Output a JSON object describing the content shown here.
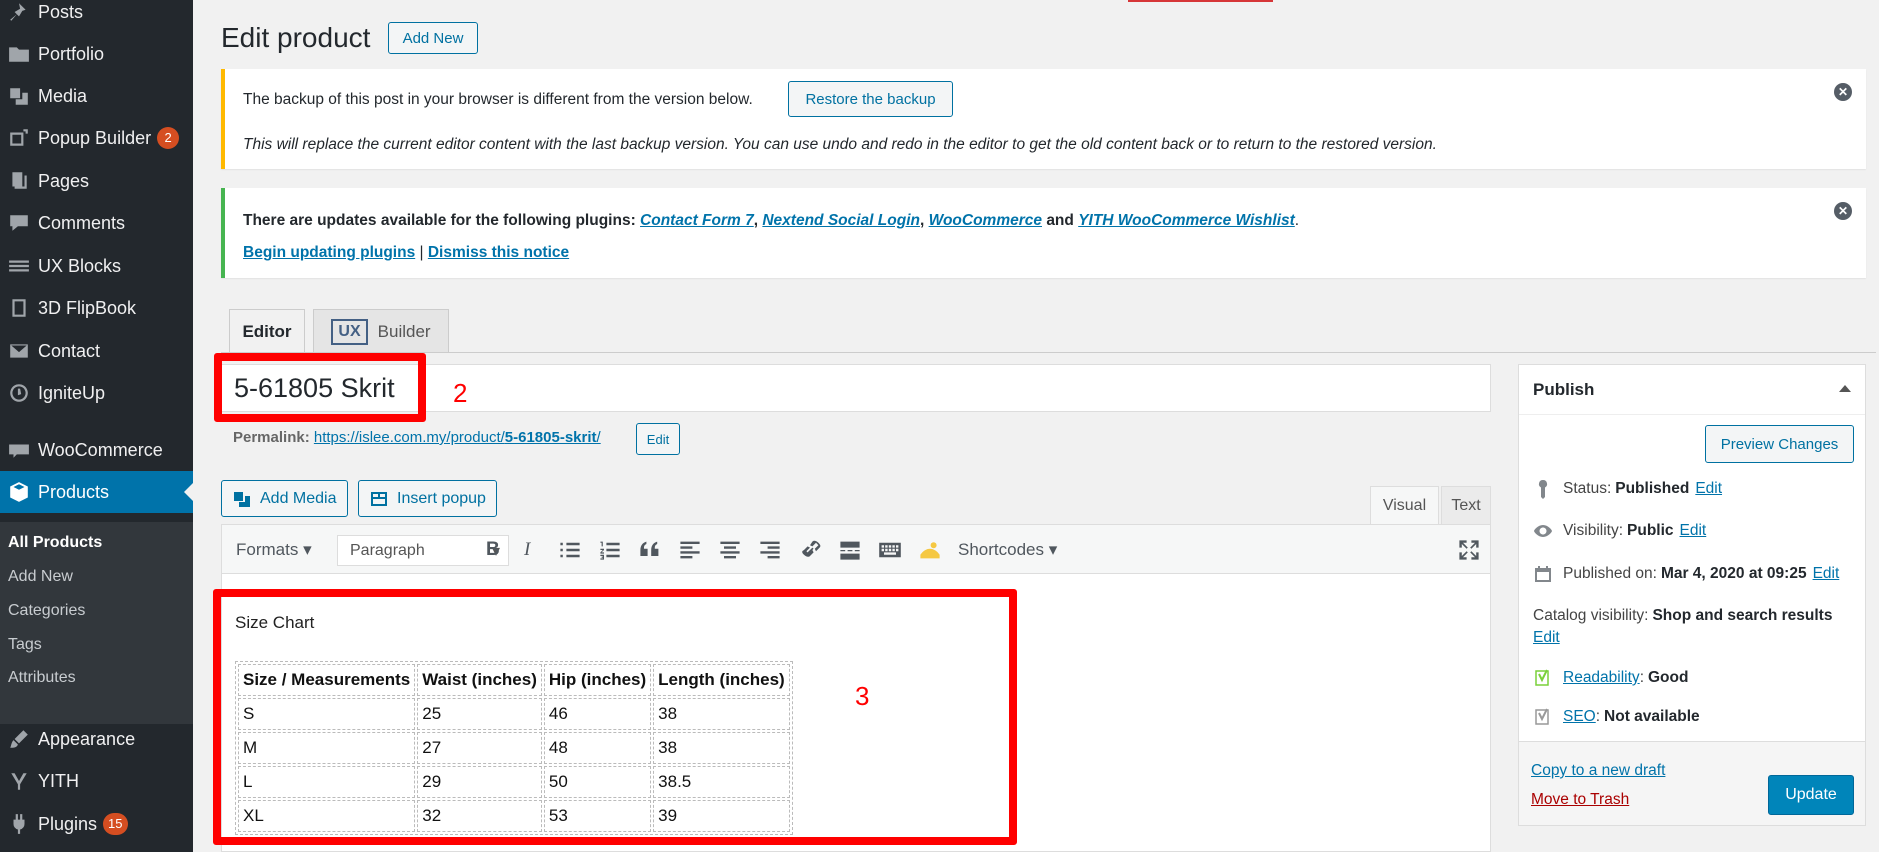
{
  "sidebar": {
    "items": [
      {
        "label": "Posts",
        "icon": "pushpin-icon"
      },
      {
        "label": "Portfolio",
        "icon": "folder-icon"
      },
      {
        "label": "Media",
        "icon": "media-icon"
      },
      {
        "label": "Popup Builder",
        "icon": "popup-icon",
        "badge": "2"
      },
      {
        "label": "Pages",
        "icon": "pages-icon"
      },
      {
        "label": "Comments",
        "icon": "comment-icon"
      },
      {
        "label": "UX Blocks",
        "icon": "blocks-icon"
      },
      {
        "label": "3D FlipBook",
        "icon": "book-icon"
      },
      {
        "label": "Contact",
        "icon": "mail-icon"
      },
      {
        "label": "IgniteUp",
        "icon": "gauge-icon"
      },
      {
        "label": "WooCommerce",
        "icon": "woo-icon"
      },
      {
        "label": "Products",
        "icon": "box-icon"
      },
      {
        "label": "Appearance",
        "icon": "brush-icon"
      },
      {
        "label": "YITH",
        "icon": "yith-icon"
      },
      {
        "label": "Plugins",
        "icon": "plugin-icon",
        "badge": "15"
      }
    ],
    "submenu": [
      "All Products",
      "Add New",
      "Categories",
      "Tags",
      "Attributes"
    ]
  },
  "header": {
    "title": "Edit product",
    "add_new": "Add New"
  },
  "backup_notice": {
    "text": "The backup of this post in your browser is different from the version below.",
    "button": "Restore the backup",
    "detail": "This will replace the current editor content with the last backup version. You can use undo and redo in the editor to get the old content back or to return to the restored version."
  },
  "update_notice": {
    "prefix": "There are updates available for the following plugins:",
    "plugins": [
      "Contact Form 7",
      "Nextend Social Login",
      "WooCommerce",
      "YITH WooCommerce Wishlist"
    ],
    "sep": ",",
    "and": "and",
    "end": ".",
    "begin_link": "Begin updating plugins",
    "pipe": "|",
    "dismiss_link": "Dismiss this notice"
  },
  "tabs": {
    "editor": "Editor",
    "ux": "UX",
    "builder": "Builder"
  },
  "post": {
    "title": "5-61805 Skrit",
    "permalink_label": "Permalink:",
    "permalink_url": "https://islee.com.my/product/",
    "permalink_slug": "5-61805-skrit",
    "permalink_tail": "/",
    "edit": "Edit"
  },
  "annotations": {
    "two": "2",
    "three": "3"
  },
  "media": {
    "add_media": "Add Media",
    "insert_popup": "Insert popup"
  },
  "editor_tabs": {
    "visual": "Visual",
    "text": "Text"
  },
  "toolbar": {
    "formats": "Formats",
    "paragraph": "Paragraph",
    "shortcodes": "Shortcodes"
  },
  "content": {
    "heading": "Size Chart",
    "table": {
      "headers": [
        "Size / Measurements",
        "Waist (inches)",
        "Hip (inches)",
        "Length (inches)"
      ],
      "rows": [
        [
          "S",
          "25",
          "46",
          "38"
        ],
        [
          "M",
          "27",
          "48",
          "38"
        ],
        [
          "L",
          "29",
          "50",
          "38.5"
        ],
        [
          "XL",
          "32",
          "53",
          "39"
        ]
      ]
    }
  },
  "publish": {
    "title": "Publish",
    "preview": "Preview Changes",
    "status_label": "Status:",
    "status": "Published",
    "visibility_label": "Visibility:",
    "visibility": "Public",
    "published_label": "Published on:",
    "published": "Mar 4, 2020 at 09:25",
    "catalog_label": "Catalog visibility:",
    "catalog": "Shop and search results",
    "readability_label": "Readability",
    "readability": "Good",
    "seo_label": "SEO",
    "seo": "Not available",
    "edit": "Edit",
    "copy_draft": "Copy to a new draft",
    "trash": "Move to Trash",
    "update": "Update"
  },
  "colors": {
    "sidebar": "#23282d",
    "active": "#0073aa",
    "annotation": "#ff0000",
    "warning": "#ffb900",
    "success": "#46b450"
  }
}
